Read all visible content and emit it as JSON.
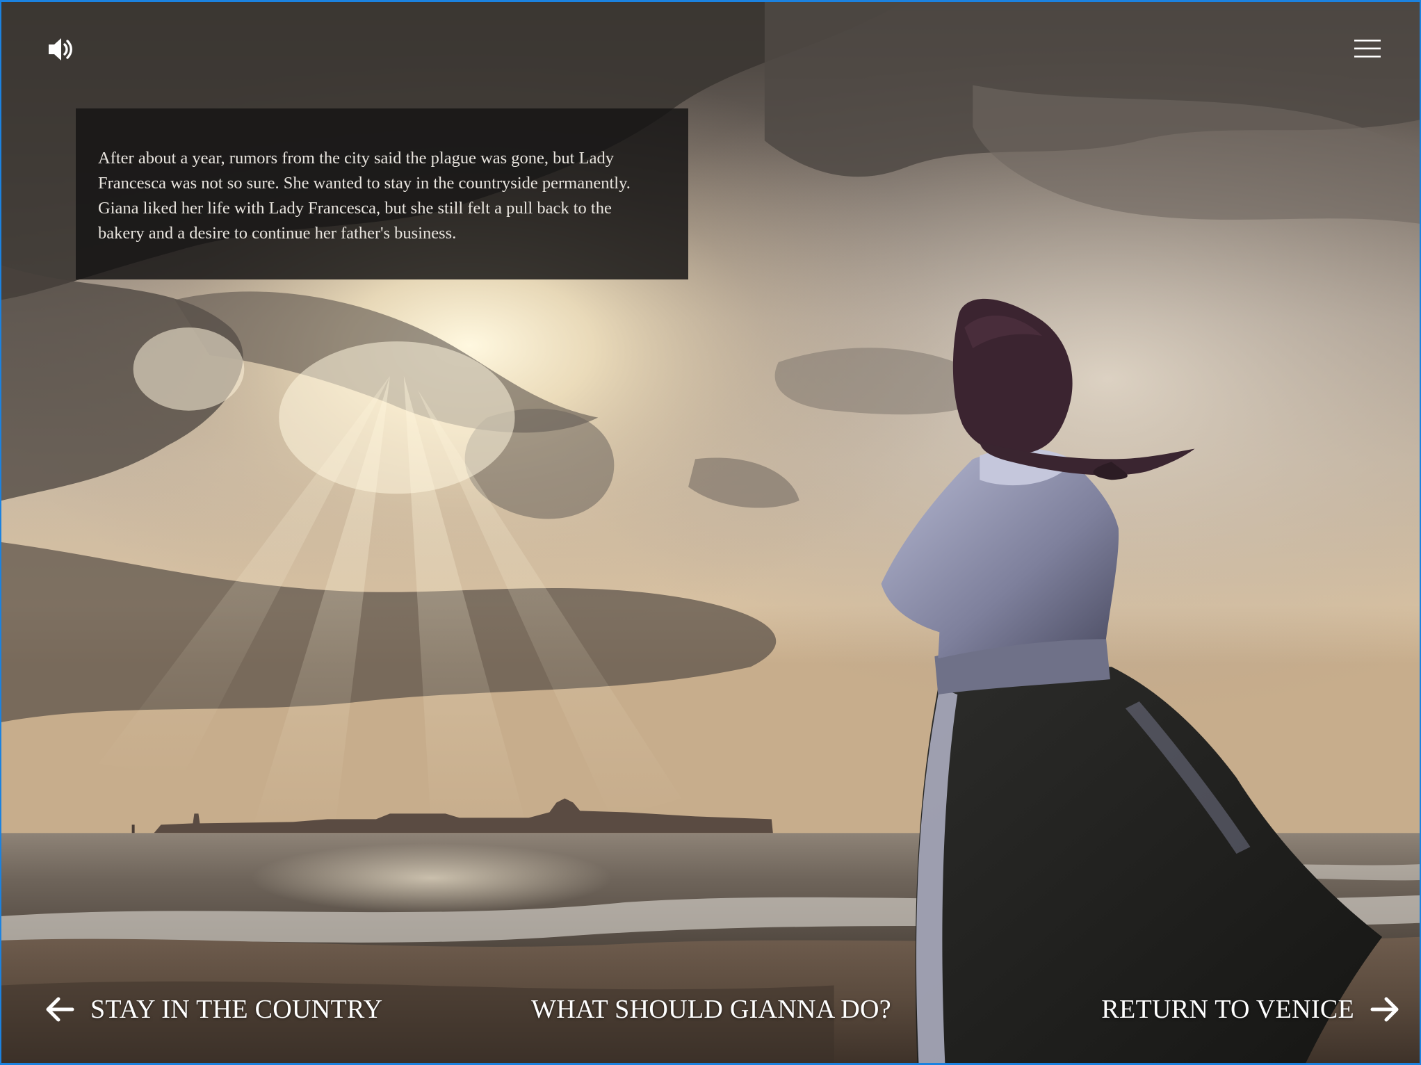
{
  "header": {
    "sound_icon": "speaker-volume-icon",
    "menu_icon": "hamburger-menu-icon"
  },
  "narration": {
    "text": "After about a year, rumors from the city said the plague was gone, but Lady Francesca was not so sure. She wanted to stay in the countryside permanently. Giana liked her life with Lady Francesca, but she still felt a pull back to the bakery and a desire to continue her father's business."
  },
  "choices": {
    "left_label": "STAY IN THE COUNTRY",
    "left_icon": "arrow-left-icon",
    "prompt": "WHAT SHOULD GIANNA DO?",
    "right_label": "RETURN TO VENICE",
    "right_icon": "arrow-right-icon"
  },
  "colors": {
    "frame_border": "#1b82e0",
    "text": "#ffffff",
    "panel": "#161414"
  }
}
